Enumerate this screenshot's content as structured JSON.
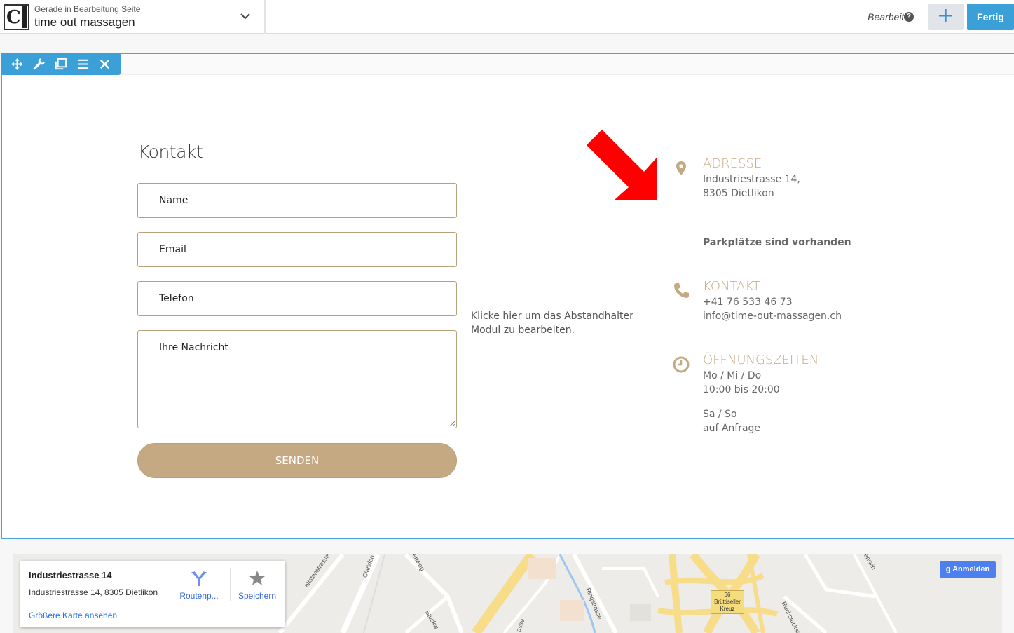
{
  "topbar": {
    "caption": "Gerade in Bearbeitung Seite",
    "page_title": "time out massagen",
    "status": "Bearbeitet",
    "help_glyph": "?",
    "add_glyph": "+",
    "done_label": "Fertig"
  },
  "module_tools": [
    "move-icon",
    "wrench-icon",
    "duplicate-icon",
    "menu-icon",
    "close-icon"
  ],
  "form": {
    "heading": "Kontakt",
    "name_placeholder": "Name",
    "email_placeholder": "Email",
    "phone_placeholder": "Telefon",
    "message_placeholder": "Ihre Nachricht",
    "submit_label": "SENDEN"
  },
  "spacer_hint": "Klicke hier um das Abstandhalter Modul zu bearbeiten.",
  "info": {
    "address": {
      "heading": "ADRESSE",
      "line1": "Industriestrasse 14,",
      "line2": "8305 Dietlikon",
      "parking": "Parkplätze sind vorhanden"
    },
    "contact": {
      "heading": "KONTAKT",
      "phone": "+41 76 533 46 73",
      "email": "info@time-out-massagen.ch"
    },
    "hours": {
      "heading": "ÖFFNUNGSZEITEN",
      "days1": "Mo / Mi / Do",
      "time1": "10:00 bis 20:00",
      "days2": "Sa / So",
      "time2": "auf Anfrage"
    }
  },
  "map": {
    "place_title": "Industriestrasse 14",
    "place_address": "Industriestrasse 14, 8305 Dietlikon",
    "larger_map_link": "Größere Karte ansehen",
    "route_label": "Routenp...",
    "save_label": "Speichern",
    "signin_label": "Anmelden",
    "junction_number": "66",
    "junction_line1": "Brüttiseller",
    "junction_line2": "Kreuz",
    "street_labels": [
      "ettstenstrasse",
      "Clariden",
      "enweg",
      "Ringstrasse",
      "Stuckw",
      "asse",
      "enrain",
      "Ruchstuckst"
    ]
  },
  "colors": {
    "accent_gold": "#c4a982",
    "editor_blue": "#3b9fd8",
    "annotation_red": "#ff0000"
  }
}
